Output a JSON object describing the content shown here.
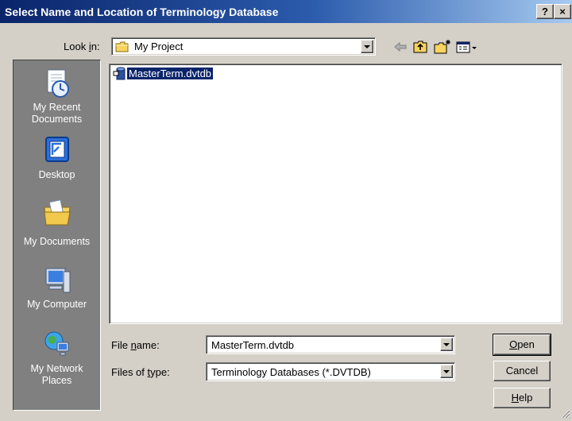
{
  "window": {
    "title": "Select Name and Location of Terminology Database",
    "help_glyph": "?",
    "close_glyph": "×"
  },
  "look_in": {
    "label_prefix": "Look ",
    "label_accel": "i",
    "label_suffix": "n:",
    "value": "My Project",
    "folder_icon": "folder-icon"
  },
  "toolbar": {
    "back_icon": "back-arrow-icon",
    "up_icon": "up-one-level-icon",
    "new_folder_icon": "new-folder-icon",
    "view_menu_icon": "view-menu-icon"
  },
  "places": [
    {
      "id": "recent",
      "label_line1": "My Recent",
      "label_line2": "Documents",
      "icon": "recent-documents-icon"
    },
    {
      "id": "desktop",
      "label_line1": "Desktop",
      "label_line2": "",
      "icon": "desktop-icon"
    },
    {
      "id": "documents",
      "label_line1": "My Documents",
      "label_line2": "",
      "icon": "my-documents-icon"
    },
    {
      "id": "computer",
      "label_line1": "My Computer",
      "label_line2": "",
      "icon": "my-computer-icon"
    },
    {
      "id": "network",
      "label_line1": "My Network",
      "label_line2": "Places",
      "icon": "network-places-icon"
    }
  ],
  "file_list": {
    "items": [
      {
        "name": "MasterTerm.dvtdb",
        "icon": "database-file-icon",
        "selected": true
      }
    ]
  },
  "file_name": {
    "label_prefix": "File ",
    "label_accel": "n",
    "label_suffix": "ame:",
    "value": "MasterTerm.dvtdb"
  },
  "file_type": {
    "label_prefix": "Files of ",
    "label_accel": "t",
    "label_suffix": "ype:",
    "value": "Terminology Databases (*.DVTDB)"
  },
  "buttons": {
    "open_accel": "O",
    "open_rest": "pen",
    "cancel": "Cancel",
    "help_accel": "H",
    "help_rest": "elp"
  }
}
